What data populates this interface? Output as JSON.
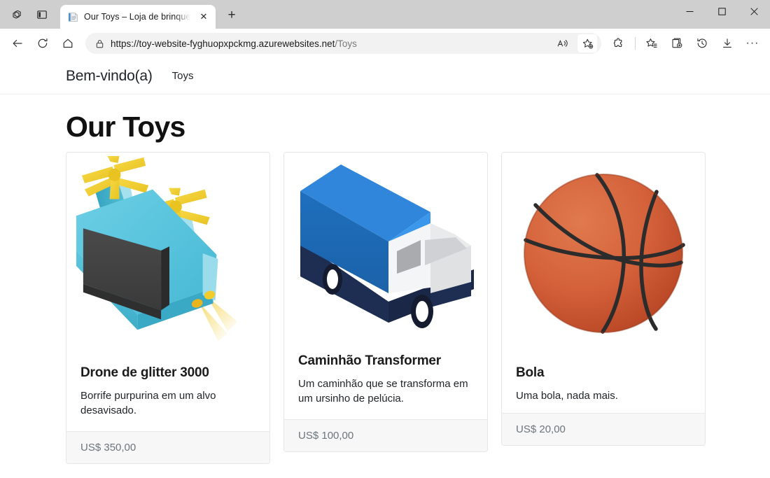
{
  "browser": {
    "left_icons": [
      {
        "name": "workspaces-icon",
        "title": "Workspaces"
      },
      {
        "name": "tab-actions-icon",
        "title": "Tab actions menu"
      }
    ],
    "tab": {
      "title": "Our Toys – Loja de brinquedos",
      "favicon": "page-icon",
      "close_label": "✕"
    },
    "new_tab_label": "+",
    "window_controls": {
      "minimize": "—",
      "maximize": "❑",
      "close": "✕"
    },
    "nav_buttons": {
      "back": "back-arrow-icon",
      "refresh": "refresh-icon",
      "home": "home-icon"
    },
    "address": {
      "lock": "lock-icon",
      "origin": "https://toy-website-fyghuopxpckmg.azurewebsites.net",
      "path": "/Toys",
      "read_aloud": "read-aloud-icon",
      "add_favorite": "add-favorite-icon"
    },
    "toolbar_icons": [
      {
        "name": "extensions-icon",
        "title": "Extensions"
      },
      {
        "name": "favorites-icon",
        "title": "Favorites"
      },
      {
        "name": "collections-icon",
        "title": "Collections"
      },
      {
        "name": "history-icon",
        "title": "History"
      },
      {
        "name": "downloads-icon",
        "title": "Downloads"
      },
      {
        "name": "settings-more-icon",
        "title": "Settings and more"
      }
    ],
    "more_label": "···"
  },
  "site": {
    "brand": "Bem-vindo(a)",
    "nav_links": [
      {
        "label": "Toys"
      }
    ],
    "page_title": "Our Toys",
    "products": [
      {
        "name": "Drone de glitter 3000",
        "description": "Borrife purpurina em um alvo desavisado.",
        "price": "US$ 350,00",
        "image": "drone-illustration"
      },
      {
        "name": "Caminhão Transformer",
        "description": "Um caminhão que se transforma em um ursinho de pelúcia.",
        "price": "US$ 100,00",
        "image": "truck-illustration"
      },
      {
        "name": "Bola",
        "description": "Uma bola, nada mais.",
        "price": "US$ 20,00",
        "image": "basketball-illustration"
      }
    ]
  },
  "colors": {
    "tabstrip": "#cfcfcf",
    "omnibox": "#f2f2f2",
    "card_border": "#e6e6e6",
    "card_footer_bg": "#f7f7f7",
    "price_text": "#6c757d",
    "drone_body": "#58c4e0",
    "drone_prop": "#f2cc2d",
    "truck_box": "#1b6ec2",
    "ball_orange": "#d35b33"
  }
}
